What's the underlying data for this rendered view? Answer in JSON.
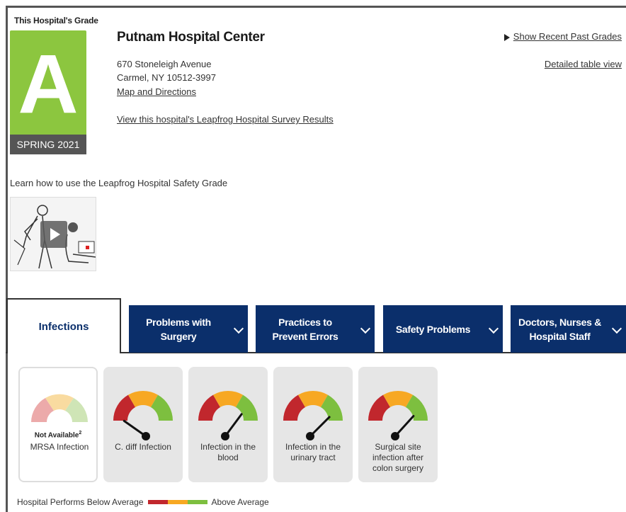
{
  "grade": {
    "label": "This Hospital's Grade",
    "letter": "A",
    "season": "SPRING 2021",
    "color": "#8cc63f"
  },
  "hospital": {
    "name": "Putnam Hospital Center",
    "address_line1": "670 Stoneleigh Avenue",
    "address_line2": "Carmel, NY 10512-3997",
    "map_link": "Map and Directions",
    "survey_link": "View this hospital's Leapfrog Hospital Survey Results"
  },
  "header_links": {
    "past_grades": "Show Recent Past Grades",
    "detailed_view": "Detailed table view"
  },
  "video": {
    "learn_text": "Learn how to use the Leapfrog Hospital Safety Grade",
    "icon": "play-icon"
  },
  "tabs": [
    {
      "label": "Infections",
      "active": true
    },
    {
      "label": "Problems with Surgery"
    },
    {
      "label": "Practices to Prevent Errors"
    },
    {
      "label": "Safety Problems"
    },
    {
      "label": "Doctors, Nurses & Hospital Staff"
    }
  ],
  "measures": [
    {
      "label": "MRSA Infection",
      "status": "Not Available",
      "footnote": "2",
      "available": false
    },
    {
      "label": "C. diff Infection",
      "level": 0.15,
      "available": true
    },
    {
      "label": "Infection in the blood",
      "level": 0.72,
      "available": true
    },
    {
      "label": "Infection in the urinary tract",
      "level": 0.78,
      "available": true
    },
    {
      "label": "Surgical site infection after colon surgery",
      "level": 0.76,
      "available": true
    }
  ],
  "legend": {
    "below": "Hospital Performs Below Average",
    "above": "Above Average"
  },
  "colors": {
    "navy": "#0b2f6b",
    "red": "#c1272d",
    "orange": "#f7a823",
    "green": "#7dbf3f"
  }
}
